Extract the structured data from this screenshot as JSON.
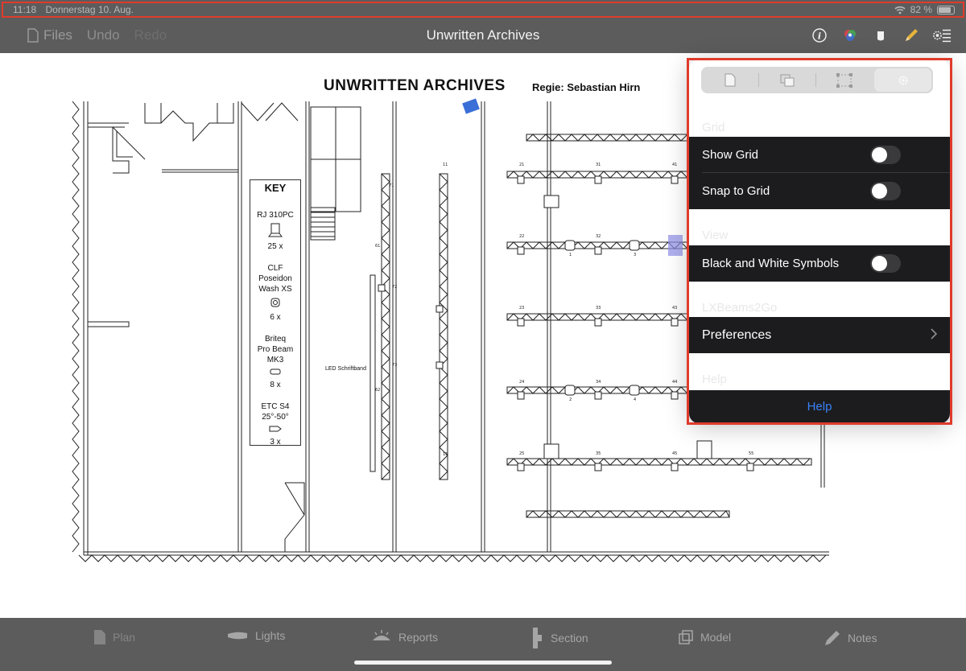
{
  "status_bar": {
    "time": "11:18",
    "date": "Donnerstag 10. Aug.",
    "battery_text": "82 %",
    "battery_level_percent": 82
  },
  "nav": {
    "files_label": "Files",
    "undo_label": "Undo",
    "redo_label": "Redo",
    "title": "Unwritten Archives",
    "icons": [
      "info-icon",
      "color-wheel-icon",
      "lamp-icon",
      "pencil-icon",
      "settings-list-icon"
    ]
  },
  "plan": {
    "title": "UNWRITTEN ARCHIVES",
    "regie": "Regie: Sebastian Hirn",
    "key": {
      "title": "KEY",
      "items": [
        {
          "name_lines": [
            "RJ 310PC"
          ],
          "count": "25 x"
        },
        {
          "name_lines": [
            "CLF",
            "Poseidon",
            "Wash XS"
          ],
          "count": "6 x"
        },
        {
          "name_lines": [
            "Briteq",
            "Pro Beam",
            "MK3"
          ],
          "count": "8 x"
        },
        {
          "name_lines": [
            "ETC S4",
            "25°-50°"
          ],
          "count": "3 x"
        }
      ]
    },
    "led_label": "LED Schriftband",
    "fixture_numbers": {
      "truss1": [
        "21",
        "31",
        "41"
      ],
      "truss2": [
        "22",
        "32"
      ],
      "truss2_sub": [
        "1",
        "3"
      ],
      "truss3": [
        "23",
        "33",
        "43"
      ],
      "truss4": [
        "24",
        "34",
        "44"
      ],
      "truss4_sub": [
        "2",
        "4"
      ],
      "truss5": [
        "25",
        "35",
        "45",
        "55"
      ],
      "vertical_left": [
        "61",
        "62",
        "71",
        "72",
        "73"
      ],
      "vertical_mid": [
        "11",
        "15"
      ]
    }
  },
  "popover": {
    "segments": [
      "document-icon",
      "copy-icon",
      "select-icon",
      "gear-icon"
    ],
    "selected_segment": 3,
    "grid_header": "Grid",
    "show_grid_label": "Show Grid",
    "show_grid_on": false,
    "snap_label": "Snap to Grid",
    "snap_on": false,
    "view_header": "View",
    "bw_label": "Black and White Symbols",
    "bw_on": false,
    "lx_header": "LXBeams2Go",
    "preferences_label": "Preferences",
    "help_header": "Help",
    "help_label": "Help"
  },
  "tabs": [
    {
      "label": "Plan",
      "icon": "document-icon"
    },
    {
      "label": "Lights",
      "icon": "light-fixture-icon"
    },
    {
      "label": "Reports",
      "icon": "reports-icon"
    },
    {
      "label": "Section",
      "icon": "section-icon"
    },
    {
      "label": "Model",
      "icon": "cube-icon"
    },
    {
      "label": "Notes",
      "icon": "pencil-icon"
    }
  ],
  "colors": {
    "chrome": "#5c5c5c",
    "dark_row": "#1c1c1e",
    "highlight": "#e03b2b",
    "link": "#3b82f6"
  }
}
